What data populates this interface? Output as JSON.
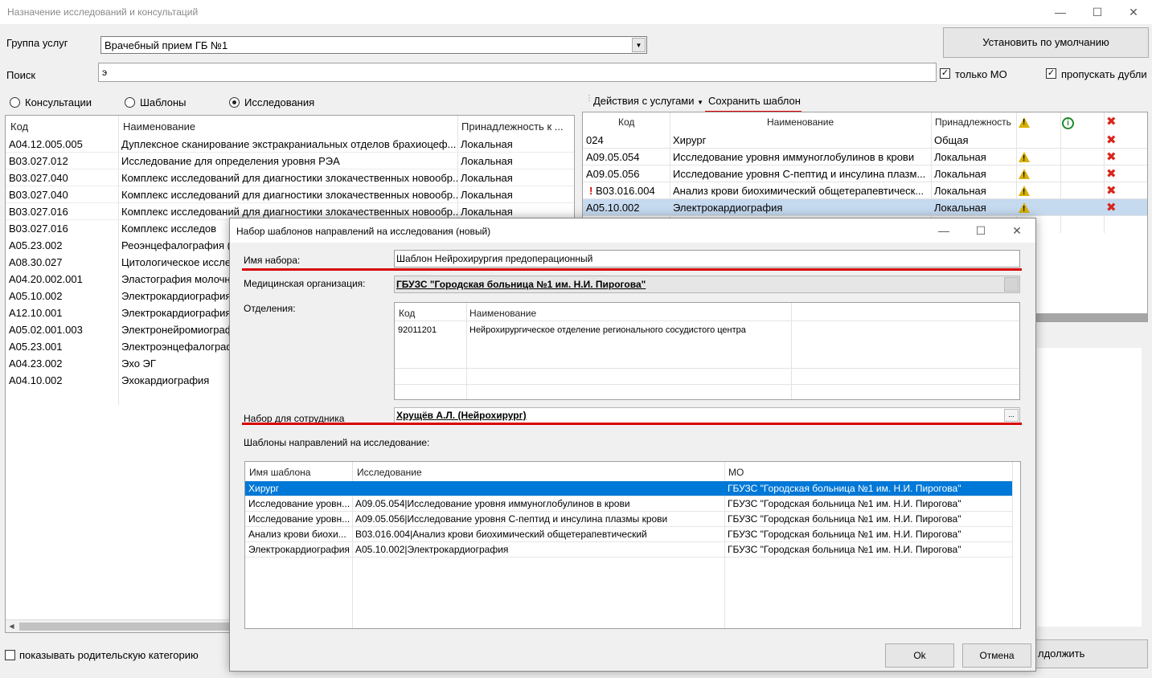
{
  "window": {
    "title": "Назначение исследований и консультаций"
  },
  "top": {
    "group_label": "Группа услуг",
    "group_value": "Врачебный прием ГБ №1",
    "search_label": "Поиск",
    "search_value": "э",
    "default_button": "Установить по умолчанию",
    "only_mo_label": "только МО",
    "skip_dupes_label": "пропускать дубли"
  },
  "radios": {
    "consult": "Консультации",
    "templates": "Шаблоны",
    "research": "Исследования",
    "selected": "research"
  },
  "left_grid": {
    "headers": [
      "Код",
      "Наименование",
      "Принадлежность к ..."
    ],
    "rows": [
      [
        "A04.12.005.005",
        "Дуплексное сканирование экстракраниальных отделов брахиоцеф...",
        "Локальная"
      ],
      [
        "B03.027.012",
        "Исследование для определения уровня РЭА",
        "Локальная"
      ],
      [
        "B03.027.040",
        "Комплекс исследований для диагностики злокачественных новообр...",
        "Локальная"
      ],
      [
        "B03.027.040",
        "Комплекс исследований для диагностики злокачественных новообр...",
        "Локальная"
      ],
      [
        "B03.027.016",
        "Комплекс исследований для диагностики злокачественных новообр...",
        "Локальная"
      ],
      [
        "B03.027.016",
        "Комплекс исследов",
        ""
      ],
      [
        "A05.23.002",
        "Реоэнцефалография (",
        ""
      ],
      [
        "A08.30.027",
        "Цитологическое иссле",
        ""
      ],
      [
        "A04.20.002.001",
        "Эластография молочн",
        ""
      ],
      [
        "A05.10.002",
        "Электрокардиография",
        ""
      ],
      [
        "A12.10.001",
        "Электрокардиография",
        ""
      ],
      [
        "A05.02.001.003",
        "Электронейромиограф",
        ""
      ],
      [
        "A05.23.001",
        "Электроэнцефалограф",
        ""
      ],
      [
        "A04.23.002",
        "Эхо ЭГ",
        ""
      ],
      [
        "A04.10.002",
        "Эхокардиография",
        ""
      ]
    ]
  },
  "show_parent_label": "показывать родительскую категорию",
  "right_toolbar": {
    "actions": "Действия с услугами",
    "save_template": "Сохранить шаблон"
  },
  "right_grid": {
    "headers": [
      "Код",
      "Наименование",
      "Принадлежность"
    ],
    "rows": [
      {
        "code": "024",
        "name": "Хирург",
        "own": "Общая",
        "warn": false,
        "flag": false
      },
      {
        "code": "A09.05.054",
        "name": "Исследование уровня иммуноглобулинов в крови",
        "own": "Локальная",
        "warn": true,
        "flag": false
      },
      {
        "code": "A09.05.056",
        "name": "Исследование уровня С-пептид и инсулина плазм...",
        "own": "Локальная",
        "warn": true,
        "flag": false
      },
      {
        "code": "B03.016.004",
        "name": "Анализ крови биохимический общетерапевтическ...",
        "own": "Локальная",
        "warn": true,
        "flag": true
      },
      {
        "code": "A05.10.002",
        "name": "Электрокардиография",
        "own": "Локальная",
        "warn": true,
        "flag": false
      }
    ]
  },
  "continue_button_partial": "лдолжить",
  "dialog": {
    "title": "Набор шаблонов направлений на исследования (новый)",
    "name_label": "Имя набора:",
    "name_value": "Шаблон Нейрохирургия предоперационный",
    "org_label": "Медицинская организация:",
    "org_value": "ГБУЗС \"Городская больница №1 им. Н.И. Пирогова\"",
    "dept_label": "Отделения:",
    "dept_headers": [
      "Код",
      "Наименование"
    ],
    "dept_rows": [
      [
        "92011201",
        "Нейрохирургическое отделение регионального сосудистого центра"
      ]
    ],
    "employee_label": "Набор для сотрудника",
    "employee_value": "Хрущёв А.Л. (Нейрохирург)",
    "ellipsis": "...",
    "templates_label": "Шаблоны направлений на исследование:",
    "tpl_headers": [
      "Имя шаблона",
      "Исследование",
      "МО"
    ],
    "tpl_rows": [
      [
        "Хирург",
        "",
        "ГБУЗС \"Городская больница №1 им. Н.И. Пирогова\""
      ],
      [
        "Исследование уровн...",
        "A09.05.054|Исследование уровня иммуноглобулинов в крови",
        "ГБУЗС \"Городская больница №1 им. Н.И. Пирогова\""
      ],
      [
        "Исследование уровн...",
        "A09.05.056|Исследование уровня С-пептид и инсулина плазмы крови",
        "ГБУЗС \"Городская больница №1 им. Н.И. Пирогова\""
      ],
      [
        "Анализ крови биохи...",
        "B03.016.004|Анализ крови биохимический общетерапевтический",
        "ГБУЗС \"Городская больница №1 им. Н.И. Пирогова\""
      ],
      [
        "Электрокардиография",
        "A05.10.002|Электрокардиография",
        "ГБУЗС \"Городская больница №1 им. Н.И. Пирогова\""
      ]
    ],
    "ok": "Ok",
    "cancel": "Отмена"
  },
  "colors": {
    "selection": "#0078d7",
    "selection_light": "#c5d9ef",
    "annotation_red": "#d80000"
  }
}
